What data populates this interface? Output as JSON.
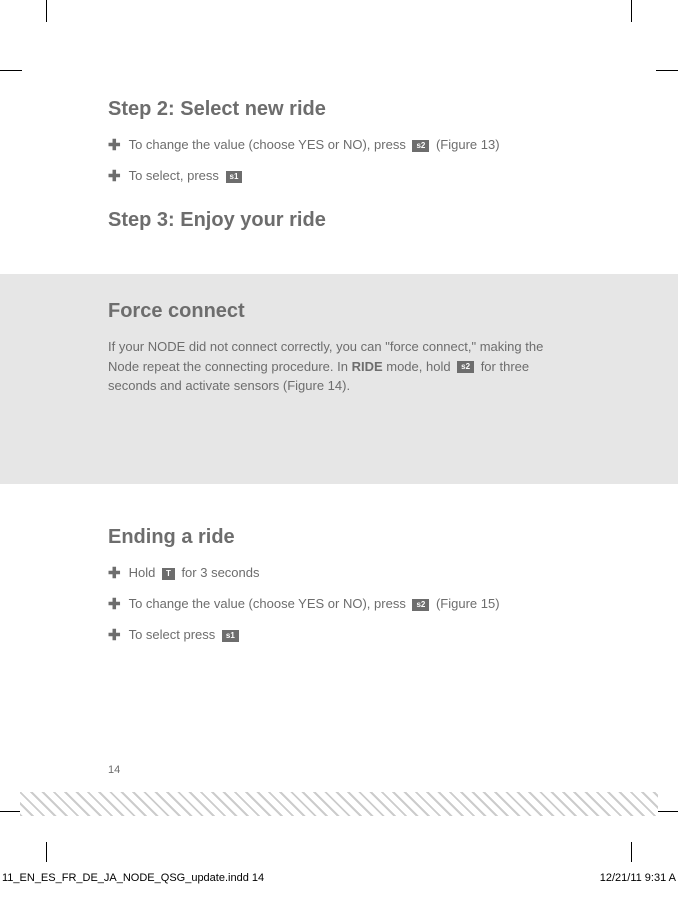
{
  "step2": {
    "heading": "Step 2: Select new ride",
    "items": [
      {
        "before": "To change the value (choose YES or NO), press ",
        "key": "s2",
        "after": " (Figure 13)"
      },
      {
        "before": "To select, press ",
        "key": "s1",
        "after": ""
      }
    ]
  },
  "step3": {
    "heading": "Step 3: Enjoy your ride"
  },
  "force": {
    "heading": "Force connect",
    "text_before": "If your NODE did not connect correctly, you can \"force connect,\" making the Node repeat the connecting procedure. In ",
    "bold": "RIDE",
    "text_mid": " mode, hold ",
    "key": "s2",
    "text_after": " for three seconds and activate sensors (Figure 14)."
  },
  "ending": {
    "heading": "Ending a ride",
    "items": [
      {
        "before": "Hold ",
        "key": "T",
        "after": " for 3 seconds"
      },
      {
        "before": "To change the value (choose YES or NO), press ",
        "key": "s2",
        "after": " (Figure 15)"
      },
      {
        "before": "To select press ",
        "key": "s1",
        "after": ""
      }
    ]
  },
  "page_number": "14",
  "footer": {
    "left": "11_EN_ES_FR_DE_JA_NODE_QSG_update.indd   14",
    "right": "12/21/11   9:31 A"
  }
}
